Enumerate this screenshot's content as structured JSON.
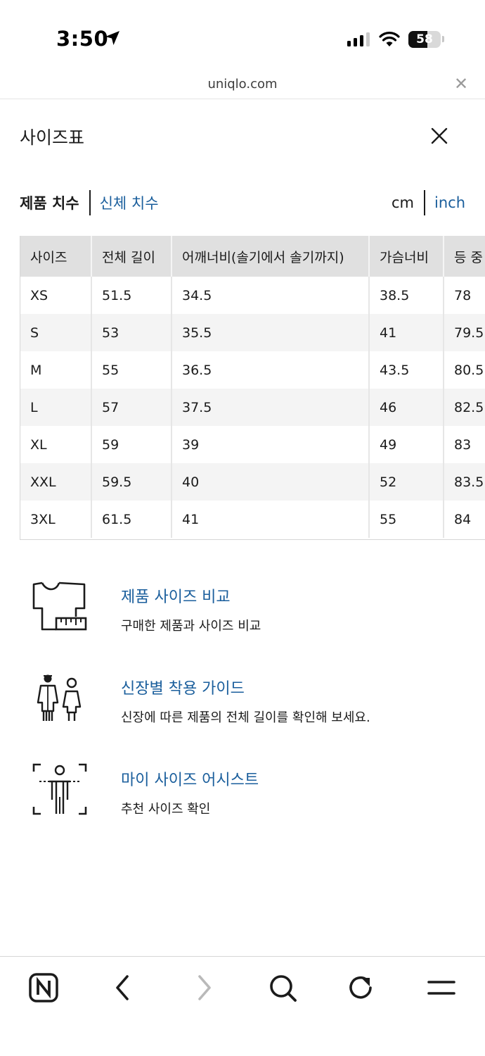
{
  "status_bar": {
    "time": "3:50",
    "battery_percent": 58,
    "battery_label": "58",
    "icons": [
      "location-arrow-icon",
      "cellular-signal-icon",
      "wifi-icon",
      "battery-icon"
    ]
  },
  "browser": {
    "url": "uniqlo.com",
    "close_icon": "close-icon"
  },
  "modal": {
    "title": "사이즈표",
    "close_icon": "close-icon"
  },
  "tabs": {
    "active": "제품 치수",
    "other": "신체 치수"
  },
  "units": {
    "active": "cm",
    "other": "inch"
  },
  "size_table": {
    "headers": [
      "사이즈",
      "전체 길이",
      "어깨너비(솔기에서 솔기까지)",
      "가슴너비",
      "등 중"
    ],
    "rows": [
      [
        "XS",
        "51.5",
        "34.5",
        "38.5",
        "78"
      ],
      [
        "S",
        "53",
        "35.5",
        "41",
        "79.5"
      ],
      [
        "M",
        "55",
        "36.5",
        "43.5",
        "80.5"
      ],
      [
        "L",
        "57",
        "37.5",
        "46",
        "82.5"
      ],
      [
        "XL",
        "59",
        "39",
        "49",
        "83"
      ],
      [
        "XXL",
        "59.5",
        "40",
        "52",
        "83.5"
      ],
      [
        "3XL",
        "61.5",
        "41",
        "55",
        "84"
      ]
    ]
  },
  "links": [
    {
      "icon": "tshirt-ruler-icon",
      "title": "제품 사이즈 비교",
      "desc": "구매한 제품과 사이즈 비교"
    },
    {
      "icon": "two-figures-icon",
      "title": "신장별 착용 가이드",
      "desc": "신장에 따른 제품의 전체 길이를 확인해 보세요."
    },
    {
      "icon": "person-scan-icon",
      "title": "마이 사이즈 어시스트",
      "desc": "추천 사이즈 확인"
    }
  ],
  "bottom_nav": {
    "icons": [
      "naver-n-icon",
      "back-icon",
      "forward-icon",
      "search-icon",
      "reload-icon",
      "menu-icon"
    ]
  },
  "colors": {
    "link": "#1a5e9c",
    "table_header_bg": "#e0e0e0",
    "table_alt_row_bg": "#f4f4f4"
  }
}
